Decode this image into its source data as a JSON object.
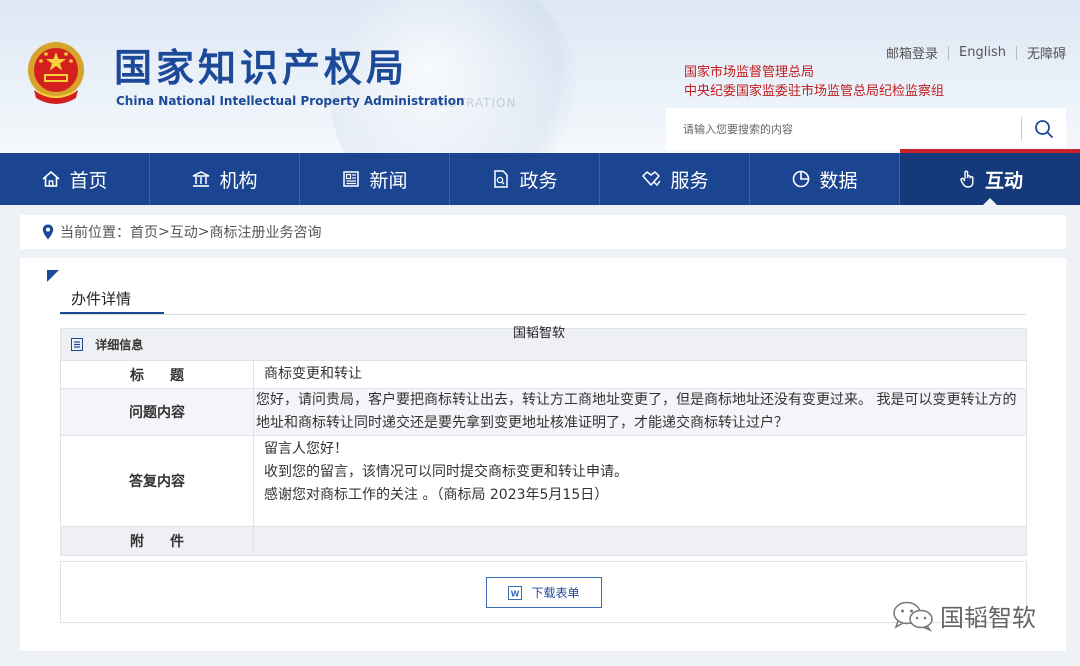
{
  "header": {
    "title_cn": "国家知识产权局",
    "title_en": "China National Intellectual Property Administration",
    "top_links": [
      "邮箱登录",
      "English",
      "无障碍"
    ],
    "red_links": [
      "国家市场监督管理总局",
      "中央纪委国家监委驻市场监管总局纪检监察组"
    ],
    "search": {
      "placeholder": "请输入您要搜索的内容"
    }
  },
  "nav": {
    "items": [
      {
        "label": "首页",
        "icon": "home-icon"
      },
      {
        "label": "机构",
        "icon": "institution-icon"
      },
      {
        "label": "新闻",
        "icon": "newspaper-icon"
      },
      {
        "label": "政务",
        "icon": "document-icon"
      },
      {
        "label": "服务",
        "icon": "service-icon"
      },
      {
        "label": "数据",
        "icon": "pie-chart-icon"
      },
      {
        "label": "互动",
        "icon": "hand-icon"
      }
    ],
    "active": "互动"
  },
  "breadcrumb": {
    "prefix": "当前位置：",
    "items": [
      "首页",
      "互动",
      "商标注册业务咨询"
    ],
    "separator": ">"
  },
  "panel": {
    "tab_title": "办件详情",
    "watermark_text": "国韬智软",
    "section_header": "详细信息",
    "rows": {
      "title_label": "标题",
      "title_value": "商标变更和转让",
      "question_label": "问题内容",
      "question_value": "您好，请问贵局，客户要把商标转让出去，转让方工商地址变更了，但是商标地址还没有变更过来。 我是可以变更转让方的地址和商标转让同时递交还是要先拿到变更地址核准证明了，才能递交商标转让过户？",
      "answer_label": "答复内容",
      "answer_lines": [
        "留言人您好！",
        "收到您的留言，该情况可以同时提交商标变更和转让申请。",
        "感谢您对商标工作的关注 。（商标局 2023年5月15日）"
      ],
      "attachment_label": "附件",
      "attachment_value": ""
    },
    "download_label": "下载表单"
  },
  "footer_watermark": "国韬智软",
  "colors": {
    "brand_blue": "#1b4591",
    "accent_red": "#c9242b",
    "link_red": "#c21c1c"
  }
}
